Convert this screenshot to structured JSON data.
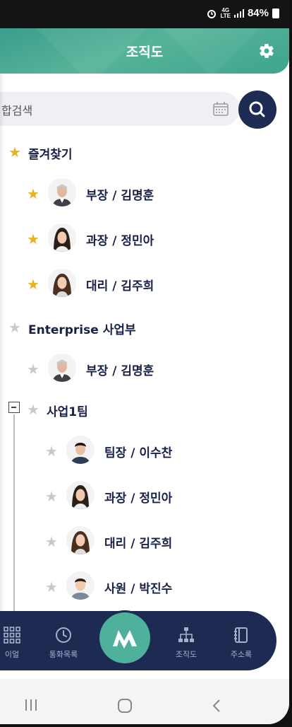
{
  "status_bar": {
    "network": "4G LTE",
    "battery": "84%"
  },
  "header": {
    "title": "조직도"
  },
  "search": {
    "placeholder": "합검색"
  },
  "favorites": {
    "title": "즐겨찾기",
    "items": [
      {
        "label": "부장 / 김명훈",
        "starred": true,
        "avatar": "older-man"
      },
      {
        "label": "과장 / 정민아",
        "starred": true,
        "avatar": "woman-1"
      },
      {
        "label": "대리 / 김주희",
        "starred": true,
        "avatar": "woman-2"
      }
    ]
  },
  "department": {
    "title": "Enterprise 사업부",
    "items": [
      {
        "label": "부장 / 김명훈",
        "avatar": "older-man"
      }
    ],
    "team": {
      "title": "사업1팀",
      "items": [
        {
          "label": "팀장 / 이수찬",
          "avatar": "young-man"
        },
        {
          "label": "과장 / 정민아",
          "avatar": "woman-1"
        },
        {
          "label": "대리 / 김주희",
          "avatar": "woman-2"
        },
        {
          "label": "사원 / 박진수",
          "avatar": "boy"
        }
      ]
    }
  },
  "bottom_nav": {
    "items": [
      {
        "label": "이얼",
        "icon": "grid-icon"
      },
      {
        "label": "통화목록",
        "icon": "clock-icon"
      },
      {
        "label": "",
        "icon": "app-logo-icon"
      },
      {
        "label": "조직도",
        "icon": "org-chart-icon"
      },
      {
        "label": "주소록",
        "icon": "address-book-icon"
      }
    ]
  },
  "colors": {
    "header": "#4fb09b",
    "navy": "#1d2a52",
    "star_active": "#e8b322",
    "star_inactive": "#c5c9d1",
    "text": "#1a2148"
  }
}
